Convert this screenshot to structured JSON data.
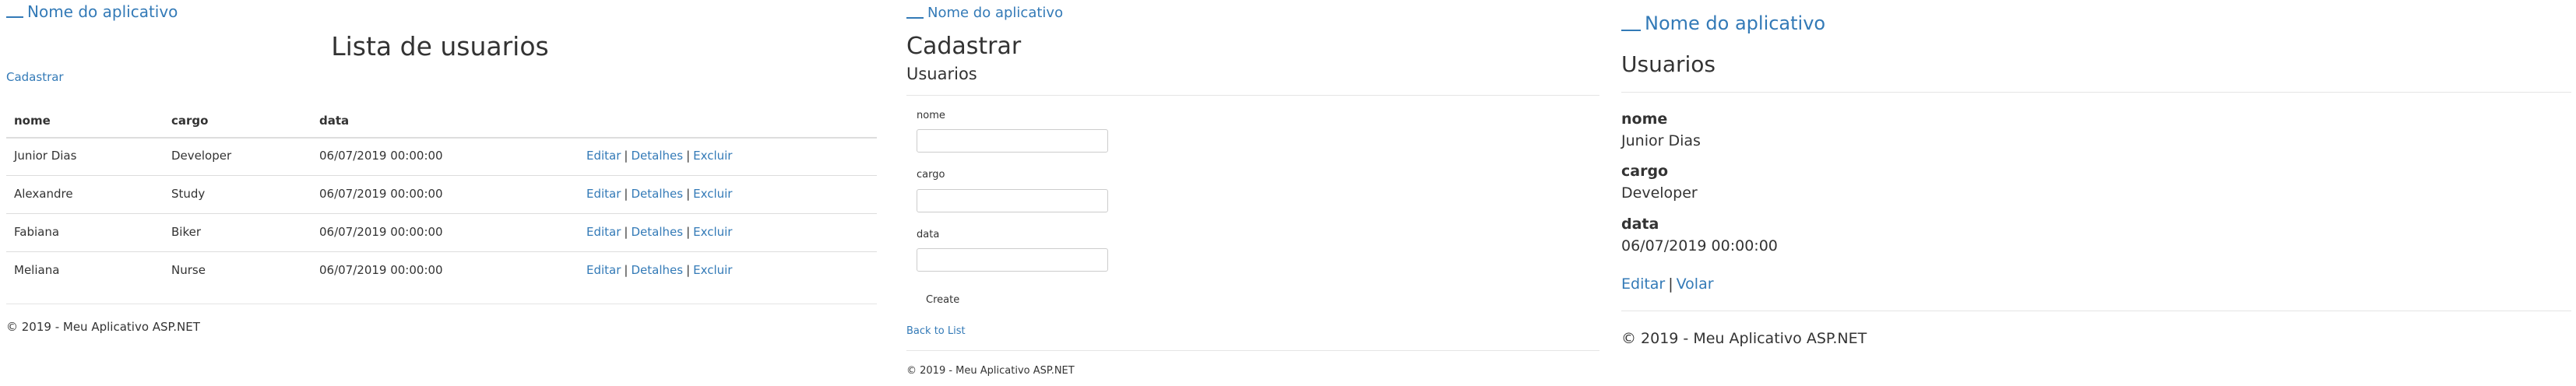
{
  "list_page": {
    "brand": "Nome do aplicativo",
    "title": "Lista de usuarios",
    "create_link": "Cadastrar",
    "table": {
      "headers": [
        "nome",
        "cargo",
        "data"
      ],
      "rows": [
        {
          "nome": "Junior Dias",
          "cargo": "Developer",
          "data": "06/07/2019 00:00:00"
        },
        {
          "nome": "Alexandre",
          "cargo": "Study",
          "data": "06/07/2019 00:00:00"
        },
        {
          "nome": "Fabiana",
          "cargo": "Biker",
          "data": "06/07/2019 00:00:00"
        },
        {
          "nome": "Meliana",
          "cargo": "Nurse",
          "data": "06/07/2019 00:00:00"
        }
      ],
      "actions": {
        "edit": "Editar",
        "details": "Detalhes",
        "delete": "Excluir",
        "separator": "|"
      }
    },
    "footer": "© 2019 - Meu Aplicativo ASP.NET"
  },
  "create_page": {
    "brand": "Nome do aplicativo",
    "heading": "Cadastrar",
    "subheading": "Usuarios",
    "fields": [
      {
        "label": "nome",
        "value": ""
      },
      {
        "label": "cargo",
        "value": ""
      },
      {
        "label": "data",
        "value": ""
      }
    ],
    "submit_label": "Create",
    "back_link": "Back to List",
    "footer": "© 2019 - Meu Aplicativo ASP.NET"
  },
  "details_page": {
    "brand": "Nome do aplicativo",
    "heading": "Usuarios",
    "fields": [
      {
        "label": "nome",
        "value": "Junior Dias"
      },
      {
        "label": "cargo",
        "value": "Developer"
      },
      {
        "label": "data",
        "value": "06/07/2019 00:00:00"
      }
    ],
    "edit_link": "Editar",
    "separator": "|",
    "back_link": "Volar",
    "footer": "© 2019 - Meu Aplicativo ASP.NET"
  },
  "colors": {
    "link": "#337ab7",
    "text": "#333333",
    "border": "#dddddd"
  }
}
